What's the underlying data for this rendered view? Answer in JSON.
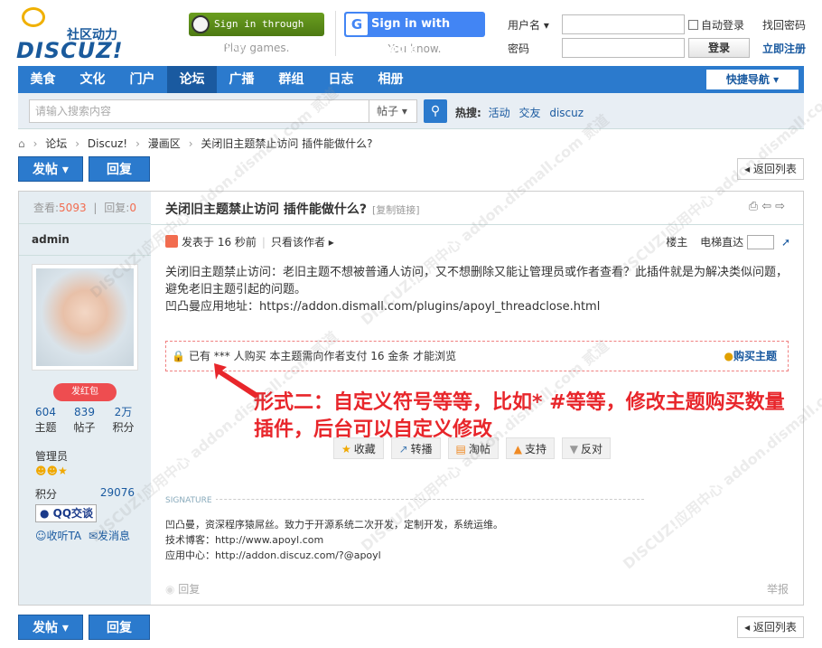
{
  "logo": {
    "cn": "社区动力",
    "en": "DISCUZ!"
  },
  "social": {
    "steam_label": "Sign in through STEAM",
    "steam_tag": "Play games.",
    "google_label": "Sign in with Google",
    "google_tag": "You know."
  },
  "login": {
    "username_label": "用户名 ▾",
    "password_label": "密码",
    "auto_login": "自动登录",
    "login_button": "登录",
    "find_password": "找回密码",
    "register": "立即注册"
  },
  "nav": {
    "items": [
      "美食",
      "文化",
      "门户",
      "论坛",
      "广播",
      "群组",
      "日志",
      "相册"
    ],
    "active": "论坛",
    "quick_nav": "快捷导航 ▾"
  },
  "search": {
    "placeholder": "请输入搜索内容",
    "type": "帖子 ▾",
    "hot_label": "热搜:",
    "hot_items": [
      "活动",
      "交友",
      "discuz"
    ]
  },
  "breadcrumb": [
    "论坛",
    "Discuz!",
    "漫画区",
    "关闭旧主题禁止访问 插件能做什么?"
  ],
  "actions": {
    "post": "发帖 ▾",
    "reply": "回复",
    "back": "◂ 返回列表"
  },
  "thread": {
    "views_label": "查看:",
    "views": "5093",
    "replies_label": "回复:",
    "replies": "0",
    "title": "关闭旧主题禁止访问 插件能做什么?",
    "copy_link": "[复制链接]",
    "author": "admin",
    "hongbao": "发红包",
    "user_stats": [
      {
        "value": "604",
        "label": "主题"
      },
      {
        "value": "839",
        "label": "帖子"
      },
      {
        "value": "2万",
        "label": "积分"
      }
    ],
    "group": "管理员",
    "credit_label": "积分",
    "credit_value": "29076",
    "qq": "QQ交谈",
    "follow": "收听TA",
    "message": "发消息",
    "posted": "发表于 16 秒前",
    "only_author": "只看该作者 ▸",
    "floor": "楼主",
    "elevator": "电梯直达",
    "content_line1": "关闭旧主题禁止访问：老旧主题不想被普通人访问，又不想删除又能让管理员或作者查看？此插件就是为解决类似问题，避免老旧主题引起的问题。",
    "content_line2": "凹凸曼应用地址：https://addon.dismall.com/plugins/apoyl_threadclose.html",
    "pay_text": "已有 *** 人购买  本主题需向作者支付 16 金条 才能浏览",
    "buy": "购买主题",
    "annotation": "形式二：自定义符号等等，比如* #等等，修改主题购买数量插件，后台可以自定义修改",
    "acts": [
      "收藏",
      "转播",
      "淘帖",
      "支持",
      "反对"
    ],
    "signature_label": "SIGNATURE",
    "signature": [
      "凹凸曼，资深程序猿屌丝。致力于开源系统二次开发，定制开发，系统运维。",
      "技术博客：http://www.apoyl.com",
      "应用中心：http://addon.discuz.com/?@apoyl"
    ],
    "reply_link": "回复",
    "report": "举报"
  },
  "watermark": "DISCUZ!应用中心 addon.dismall.com 贰道"
}
